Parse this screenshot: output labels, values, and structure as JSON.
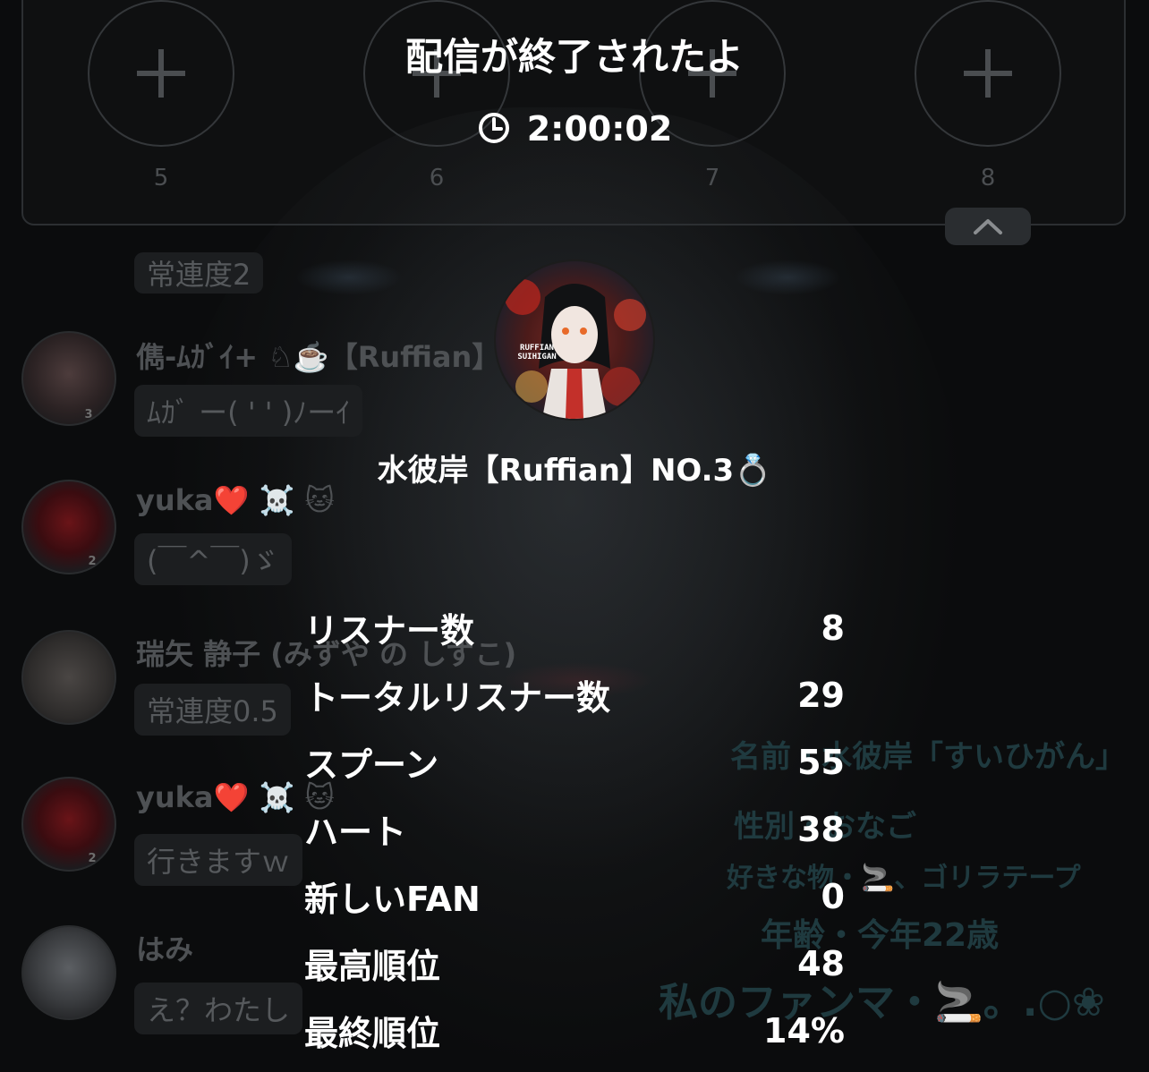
{
  "slots": [
    {
      "number": "5"
    },
    {
      "number": "6"
    },
    {
      "number": "7"
    },
    {
      "number": "8"
    }
  ],
  "chat": [
    {
      "name": "",
      "message": "常連度2"
    },
    {
      "name": "儁-ﾑｶﾞｲ+ ♘☕️【Ruffian】",
      "message": "ﾑｶﾞ ー( ' ' )ﾉーｲ",
      "rank": "3"
    },
    {
      "name": "yuka❤️ ☠️ 🐱",
      "message": "(￣^￣)ゞ",
      "rank": "2"
    },
    {
      "name": "瑞矢 静子 (みずや の しずこ)",
      "message": "常連度0.5"
    },
    {
      "name": "yuka❤️ ☠️ 🐱",
      "message": "行きますｗ",
      "rank": "2"
    },
    {
      "name": "はみ",
      "message": "え？わたし"
    }
  ],
  "background_profile": [
    "名前・水彼岸「すいひがん」",
    "性別・おなご",
    "好きな物・🚬、ゴリラテープ",
    "年齢・今年22歳",
    "私のファンマ・🚬。.○❀"
  ],
  "end_screen": {
    "title": "配信が終了されたよ",
    "duration": "2:00:02",
    "host_name": "水彼岸【Ruffian】NO.3💍",
    "avatar_text": "RUFFIAN SUIHIGAN",
    "stats": [
      {
        "label": "リスナー数",
        "value": "8"
      },
      {
        "label": "トータルリスナー数",
        "value": "29"
      },
      {
        "label": "スプーン",
        "value": "55"
      },
      {
        "label": "ハート",
        "value": "38"
      },
      {
        "label": "新しいFAN",
        "value": "0"
      },
      {
        "label": "最高順位",
        "value": "48"
      },
      {
        "label": "最終順位",
        "value": "14%"
      }
    ]
  },
  "colors": {
    "background": "#0b0c0d",
    "text_primary": "#ffffff",
    "dim_text": "#4e5154"
  }
}
